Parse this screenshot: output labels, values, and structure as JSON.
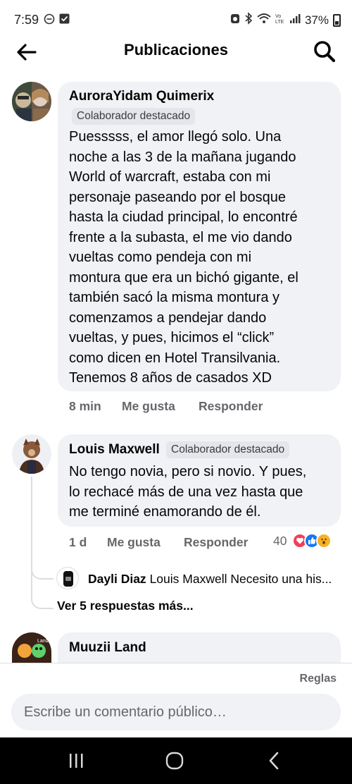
{
  "status_bar": {
    "time": "7:59",
    "battery": "37%"
  },
  "header": {
    "title": "Publicaciones",
    "back_icon": "arrow-left-icon",
    "search_icon": "search-icon"
  },
  "comments": [
    {
      "author": "AuroraYidam Quimerix",
      "badge": "Colaborador destacado",
      "lines": [
        "Puesssss, el amor llegó solo. Una",
        "noche a las 3 de la mañana jugando",
        "World of warcraft, estaba con mi",
        "personaje paseando por el bosque",
        "hasta la ciudad principal, lo encontré",
        "frente a la subasta, el me vio dando",
        "vueltas como pendeja con mi",
        "montura que era un bichó gigante, el",
        "también sacó la misma montura y",
        "comenzamos a pendejar dando",
        "vueltas, y pues, hicimos el “click”",
        "como dicen en Hotel Transilvania.",
        "Tenemos 8 años de casados XD"
      ],
      "time": "8 min",
      "like_label": "Me gusta",
      "reply_label": "Responder"
    },
    {
      "author": "Louis Maxwell",
      "badge": "Colaborador destacado",
      "lines": [
        "No tengo novia, pero si novio. Y pues,",
        "lo rechacé más de una vez hasta que",
        "me terminé enamorando de él."
      ],
      "time": "1 d",
      "like_label": "Me gusta",
      "reply_label": "Responder",
      "reaction_count": "40",
      "reply_preview": {
        "author": "Dayli Diaz",
        "text": "Louis Maxwell Necesito una his..."
      },
      "more_replies": "Ver 5 respuestas más..."
    },
    {
      "author": "Muuzii Land"
    }
  ],
  "footer": {
    "rules_label": "Reglas",
    "composer_placeholder": "Escribe un comentario público…"
  },
  "colors": {
    "bubble": "#f0f2f5",
    "badge": "#e4e6eb",
    "secondary_text": "#65676b",
    "like_blue": "#1877f2",
    "love_red": "#f33e58",
    "wow_yellow": "#f7b125"
  }
}
